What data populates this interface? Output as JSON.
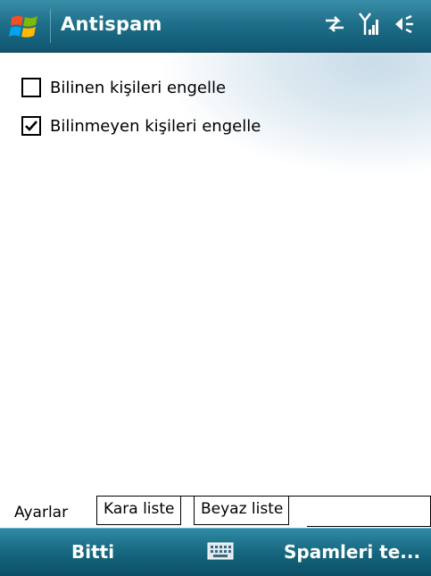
{
  "title_bar": {
    "start_icon": "windows-flag-icon",
    "title": "Antispam",
    "status_icons": [
      "sync-arrows-icon",
      "signal-icon",
      "volume-icon"
    ]
  },
  "options": [
    {
      "label": "Bilinen kişileri engelle",
      "checked": false
    },
    {
      "label": "Bilinmeyen kişileri engelle",
      "checked": true
    }
  ],
  "tabs": [
    {
      "label": "Ayarlar",
      "active": true
    },
    {
      "label": "Kara liste",
      "active": false
    },
    {
      "label": "Beyaz liste",
      "active": false
    }
  ],
  "softkeys": {
    "left": "Bitti",
    "center_icon": "keyboard-icon",
    "right": "Spamleri te..."
  },
  "colors": {
    "bar_top": "#3a8fa8",
    "bar_bottom": "#0f5670"
  }
}
